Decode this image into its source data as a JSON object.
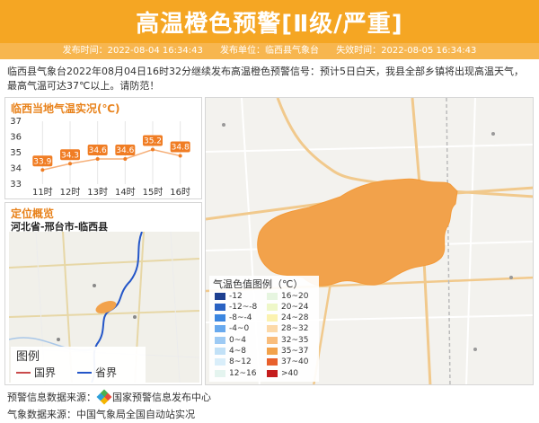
{
  "header": {
    "title": "高温橙色预警[Ⅱ级/严重]",
    "issue_time_label": "发布时间：",
    "issue_time": "2022-08-04 16:34:43",
    "issuer_label": "发布单位：",
    "issuer": "临西县气象台",
    "expire_label": "失效时间：",
    "expire_time": "2022-08-05 16:34:43"
  },
  "description": "临西县气象台2022年08月04日16时32分继续发布高温橙色预警信号：预计5日白天，我县全部乡镇将出现高温天气，最高气温可达37℃以上。请防范！",
  "temp_panel": {
    "title": "临西当地气温实况(℃)",
    "chart_data": {
      "type": "line",
      "title": "临西当地气温实况(℃)",
      "categories": [
        "11时",
        "12时",
        "13时",
        "14时",
        "15时",
        "16时"
      ],
      "values": [
        33.9,
        34.3,
        34.6,
        34.6,
        35.2,
        34.8
      ],
      "ylim": [
        33,
        37
      ],
      "yticks": [
        "37",
        "36",
        "35",
        "34",
        "33"
      ],
      "grid": true,
      "line_color": "#f6b07a",
      "label_color": "#f07d24"
    }
  },
  "location": {
    "title": "定位概览",
    "path": "河北省-邢台市-临西县",
    "legend_title": "图例",
    "legend_items": [
      {
        "label": "国界",
        "color": "#c94b4b"
      },
      {
        "label": "省界",
        "color": "#2456c8"
      }
    ]
  },
  "map_legend": {
    "title": "气温色值图例（℃）",
    "items": [
      {
        "label": "-12",
        "color": "#1d3f8f"
      },
      {
        "label": "16~20",
        "color": "#e6f5e0"
      },
      {
        "label": "-12~-8",
        "color": "#2a62c2"
      },
      {
        "label": "20~24",
        "color": "#eef7c8"
      },
      {
        "label": "-8~-4",
        "color": "#3b86e0"
      },
      {
        "label": "24~28",
        "color": "#fbf2b0"
      },
      {
        "label": "-4~0",
        "color": "#68a9ee"
      },
      {
        "label": "28~32",
        "color": "#fcd9a8"
      },
      {
        "label": "0~4",
        "color": "#9dcaf4"
      },
      {
        "label": "32~35",
        "color": "#f9bd7c"
      },
      {
        "label": "4~8",
        "color": "#c2e1f7"
      },
      {
        "label": "35~37",
        "color": "#f2a24b"
      },
      {
        "label": "8~12",
        "color": "#d9eefa"
      },
      {
        "label": "37~40",
        "color": "#e8602c"
      },
      {
        "label": "12~16",
        "color": "#e4f4ef"
      },
      {
        "label": ">40",
        "color": "#c41c1c"
      }
    ]
  },
  "sources": {
    "warning_label": "预警信息数据来源：",
    "warning_source": "国家预警信息发布中心",
    "weather_label": "气象数据来源：",
    "weather_source": "中国气象局全国自动站实况"
  }
}
